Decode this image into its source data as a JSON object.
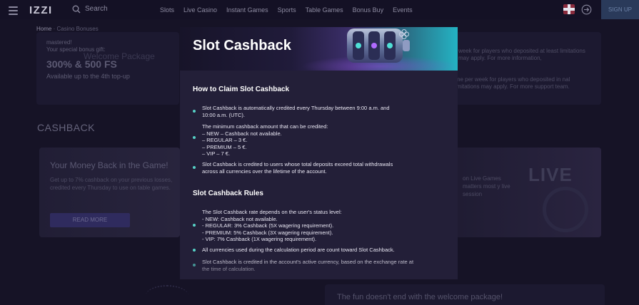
{
  "header": {
    "logo": "IZZI",
    "search_label": "Search",
    "nav": [
      "Slots",
      "Live Casino",
      "Instant Games",
      "Sports",
      "Table Games",
      "Bonus Buy",
      "Events"
    ],
    "signup_label": "SIGN UP"
  },
  "background": {
    "breadcrumb_home": "Home",
    "breadcrumb_current": "Casino Bonuses",
    "bonus_card": {
      "title": "Welcome Package",
      "line1": "mastered!",
      "line2": "Your special bonus gift:",
      "amount": "300% & 500 FS",
      "sub": "Available up to the 4th top-up"
    },
    "right_card": {
      "para1": "week for players who deposited at least limitations may apply. For more information,",
      "para2": "ime per week for players who deposited in nal limitations may apply. For more support team."
    },
    "section_title": "CASHBACK",
    "cashback_card": {
      "title": "Your Money Back in the Game!",
      "desc": "Get up to 7% cashback on your previous losses, credited every Thursday to use on table games."
    },
    "read_more": "READ MORE",
    "live_card": {
      "desc": "on Live Games matters most y live session"
    },
    "live_label": "LIVE",
    "fun_text": "The fun doesn't end with the welcome package!"
  },
  "modal": {
    "title": "Slot Cashback",
    "section1_title": "How to Claim Slot Cashback",
    "section1_items": [
      "Slot Cashback is automatically credited every Thursday between 9:00 a.m. and\n10:00 a.m. (UTC).",
      "The minimum cashback amount that can be credited:\n– NEW – Cashback not available.\n– REGULAR – 3 €.\n– PREMIUM – 5 €.\n– VIP – 7 €.",
      "Slot Cashback is credited to users whose total deposits exceed total withdrawals\nacross all currencies over the lifetime of the account."
    ],
    "section2_title": "Slot Cashback Rules",
    "section2_items": [
      "The Slot Cashback rate depends on the user's status level:\n- NEW: Cashback not available.\n- REGULAR: 3% Cashback (5X wagering requirement).\n- PREMIUM: 5% Cashback (3X wagering requirement).\n- VIP: 7% Cashback (1X wagering requirement).",
      "All currencies used during the calculation period are count toward Slot Cashback.",
      "Slot Cashback is credited in the account's active currency, based on the exchange rate at\nthe time of calculation."
    ]
  },
  "colors": {
    "page_bg": "#161326",
    "modal_bg": "#231f38",
    "bullet": "#56d1c6",
    "banner_accent": "#24b3c3"
  },
  "icons": [
    "menu-icon",
    "search-icon",
    "uk-flag-icon",
    "login-icon",
    "slot-machine-icon",
    "clover-icon"
  ]
}
